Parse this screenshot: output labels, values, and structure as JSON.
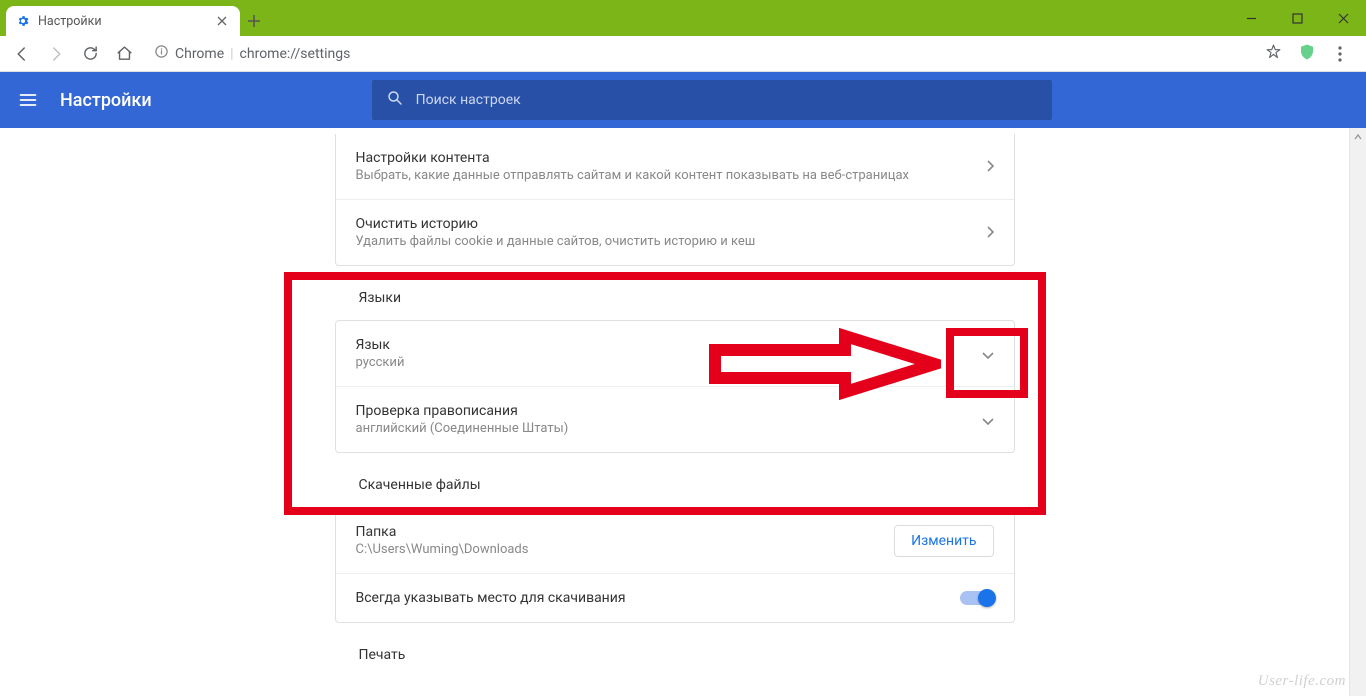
{
  "window": {
    "tabTitle": "Настройки",
    "newTab": "+"
  },
  "toolbar": {
    "chromeChip": "Chrome",
    "url": "chrome://settings"
  },
  "header": {
    "title": "Настройки",
    "searchPlaceholder": "Поиск настроек"
  },
  "topCard": {
    "items": [
      {
        "title": "Настройки контента",
        "subtitle": "Выбрать, какие данные отправлять сайтам и какой контент показывать на веб-страницах"
      },
      {
        "title": "Очистить историю",
        "subtitle": "Удалить файлы cookie и данные сайтов, очистить историю и кеш"
      }
    ]
  },
  "languages": {
    "section": "Языки",
    "items": [
      {
        "title": "Язык",
        "subtitle": "русский"
      },
      {
        "title": "Проверка правописания",
        "subtitle": "английский (Соединенные Штаты)"
      }
    ]
  },
  "downloads": {
    "section": "Скаченные файлы",
    "folderLabel": "Папка",
    "folderPath": "C:\\Users\\Wuming\\Downloads",
    "changeBtn": "Изменить",
    "askWhere": "Всегда указывать место для скачивания"
  },
  "print": {
    "section": "Печать"
  },
  "watermark": "User-life.com"
}
